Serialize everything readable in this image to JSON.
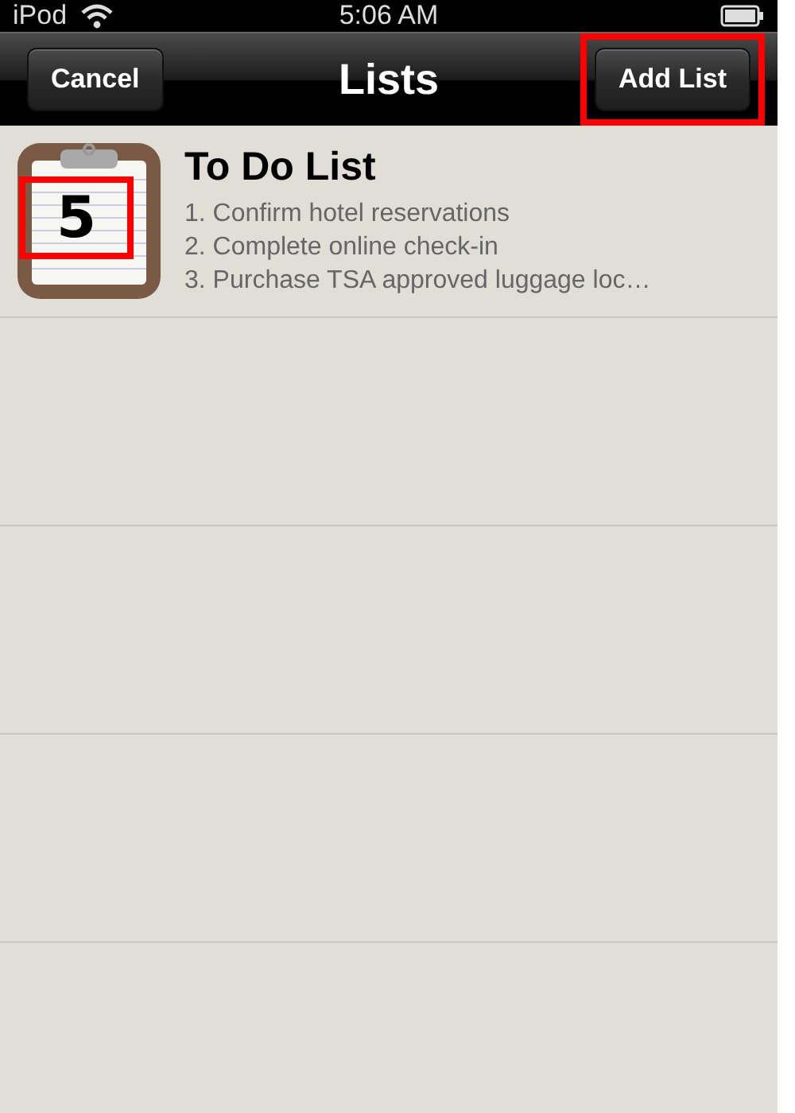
{
  "status_bar": {
    "carrier": "iPod",
    "time": "5:06 AM"
  },
  "nav_bar": {
    "title": "Lists",
    "left_button": {
      "label": "Cancel",
      "highlighted": false
    },
    "right_button": {
      "label": "Add List",
      "highlighted": true
    }
  },
  "lists": [
    {
      "title": "To Do List",
      "count": "5",
      "count_highlighted": true,
      "items": [
        "1. Confirm hotel reservations",
        "2. Complete online check-in",
        "3. Purchase TSA approved luggage loc…"
      ]
    }
  ]
}
